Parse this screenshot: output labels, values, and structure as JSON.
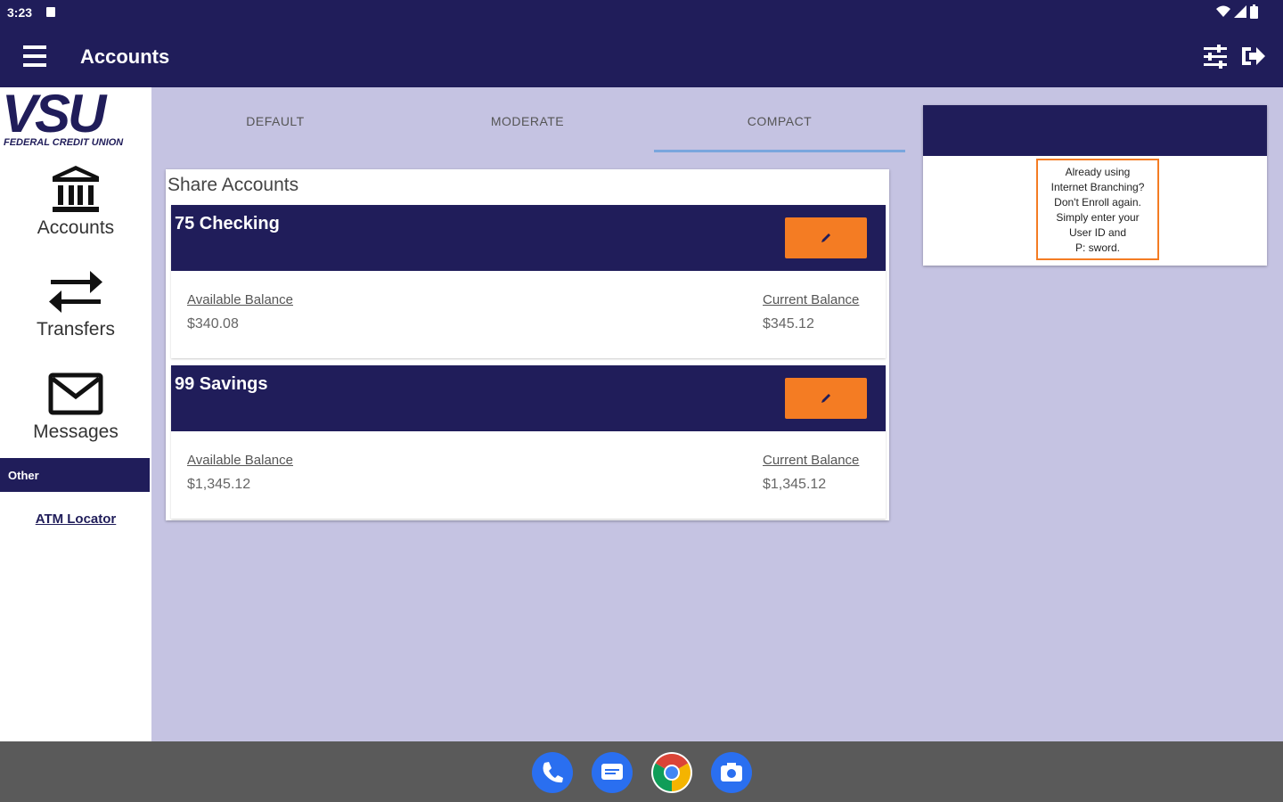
{
  "status_bar": {
    "time": "3:23"
  },
  "app_bar": {
    "title": "Accounts"
  },
  "sidebar": {
    "logo_text": "VSU",
    "logo_subtitle": "FEDERAL CREDIT UNION",
    "items": [
      {
        "label": "Accounts",
        "icon": "bank-icon"
      },
      {
        "label": "Transfers",
        "icon": "transfer-arrows-icon"
      },
      {
        "label": "Messages",
        "icon": "envelope-icon"
      }
    ],
    "other_header": "Other",
    "other_links": [
      {
        "label": "ATM Locator"
      }
    ]
  },
  "tabs": [
    {
      "label": "DEFAULT",
      "active": false
    },
    {
      "label": "MODERATE",
      "active": false
    },
    {
      "label": "COMPACT",
      "active": true
    }
  ],
  "accounts_panel": {
    "title": "Share Accounts",
    "accounts": [
      {
        "name": "75 Checking",
        "available_label": "Available Balance",
        "available_value": "$340.08",
        "current_label": "Current Balance",
        "current_value": "$345.12"
      },
      {
        "name": "99 Savings",
        "available_label": "Available Balance",
        "available_value": "$1,345.12",
        "current_label": "Current Balance",
        "current_value": "$1,345.12"
      }
    ]
  },
  "promo": {
    "lines": [
      "Already using",
      "Internet Branching?",
      "Don't Enroll again.",
      "Simply enter your",
      "User ID and",
      "P:   sword."
    ]
  },
  "colors": {
    "primary": "#201d5a",
    "accent": "#f47c23",
    "background": "#c5c3e2"
  },
  "dock": [
    "phone-icon",
    "messages-icon",
    "chrome-icon",
    "camera-icon"
  ]
}
